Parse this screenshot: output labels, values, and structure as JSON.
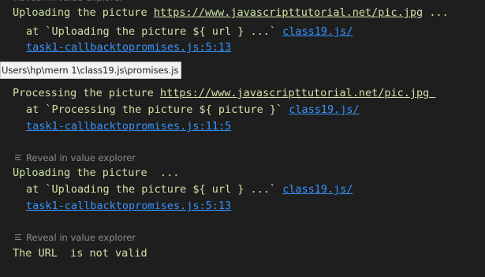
{
  "explorer_label": "Reveal in value explorer",
  "tooltip_path": "Users\\hp\\mern 1\\class19.js\\promises.js",
  "blocks": [
    {
      "message": "Uploading the picture https://www.javascripttutorial.net/pic.jpg ...",
      "message_prefix": "Uploading the picture ",
      "message_link": "https://www.javascripttutorial.net/pic.jpg",
      "message_suffix": " ...",
      "at_text": "at `Uploading the picture ${ url } ...` ",
      "file_link": "class19.js/",
      "location_link": "task1-callbacktopromises.js:5:13"
    },
    {
      "message_prefix": "Processing the picture ",
      "message_link": "https://www.javascripttutorial.net/pic.jpg ",
      "at_text": "at `Processing the picture ${ picture }` ",
      "file_link": "class19.js/",
      "location_link": "task1-callbacktopromises.js:11:5"
    },
    {
      "message": "Uploading the picture  ...",
      "at_text": "at `Uploading the picture ${ url } ...` ",
      "file_link": "class19.js/",
      "location_link": "task1-callbacktopromises.js:5:13"
    },
    {
      "message": "The URL  is not valid"
    }
  ]
}
